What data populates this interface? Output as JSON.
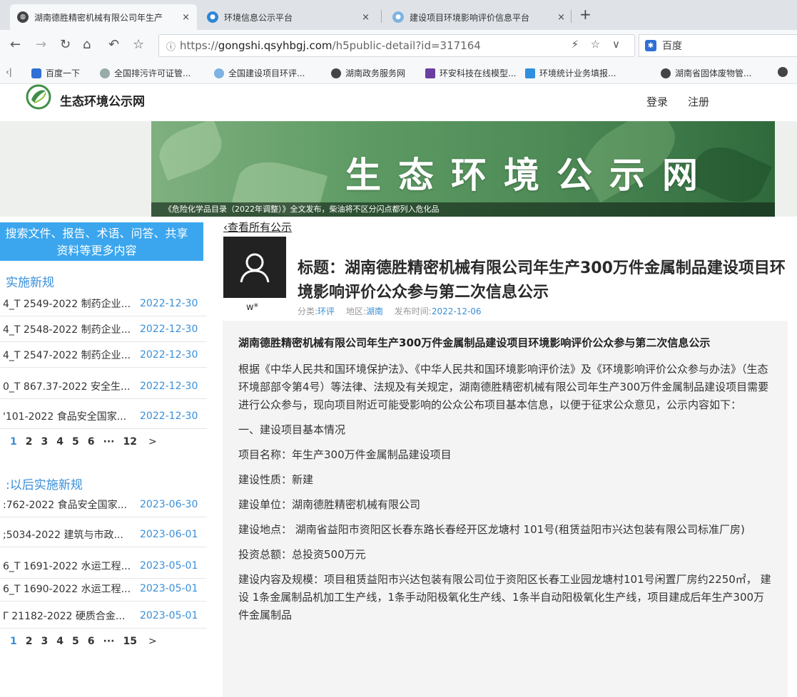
{
  "browser": {
    "tabs": [
      {
        "label": "湖南德胜精密机械有限公司年生产",
        "close": "×"
      },
      {
        "label": "环境信息公示平台",
        "close": "×"
      },
      {
        "label": "建设项目环境影响评价信息平台",
        "close": "×"
      }
    ],
    "new_tab": "+",
    "url_scheme": "https://",
    "url_host": "gongshi.qsyhbgj.com",
    "url_path": "/h5public-detail?id=317164",
    "search_engine": "百度",
    "bookmarks": [
      "百度一下",
      "全国排污许可证管...",
      "全国建设项目环评...",
      "湖南政务服务网",
      "环安科技在线模型...",
      "环境统计业务填报...",
      "湖南省固体废物管..."
    ]
  },
  "site": {
    "name": "生态环境公示网",
    "login": "登录",
    "register": "注册",
    "banner_title": "生态环境公示网",
    "ticker": "《危险化学品目录（2022年调整）》全文发布，柴油将不区分闪点都列入危化品"
  },
  "sidebar": {
    "search_cta": "搜索文件、报告、术语、问答、共享资料等更多内容",
    "section1_title": "实施新规",
    "section1_items": [
      {
        "title": "4_T 2549-2022 制药企业...",
        "date": "2022-12-30"
      },
      {
        "title": "4_T 2548-2022 制药企业...",
        "date": "2022-12-30"
      },
      {
        "title": "4_T 2547-2022 制药企业...",
        "date": "2022-12-30"
      },
      {
        "title": "0_T 867.37-2022 安全生...",
        "date": "2022-12-30"
      },
      {
        "title": "'101-2022 食品安全国家...",
        "date": "2022-12-30"
      }
    ],
    "section1_pager": [
      "1",
      "2",
      "3",
      "4",
      "5",
      "6",
      "···",
      "12",
      ">"
    ],
    "section2_title": ":以后实施新规",
    "section2_items": [
      {
        "title": ":762-2022 食品安全国家...",
        "date": "2023-06-30"
      },
      {
        "title": ";5034-2022 建筑与市政...",
        "date": "2023-06-01"
      },
      {
        "title": "6_T 1691-2022 水运工程...",
        "date": "2023-05-01"
      },
      {
        "title": "6_T 1690-2022 水运工程...",
        "date": "2023-05-01"
      },
      {
        "title": "Γ 21182-2022 硬质合金...",
        "date": "2023-05-01"
      }
    ],
    "section2_pager": [
      "1",
      "2",
      "3",
      "4",
      "5",
      "6",
      "···",
      "15",
      ">"
    ]
  },
  "article": {
    "back_link": "查看所有公示",
    "author": "w*",
    "title": "标题：湖南德胜精密机械有限公司年生产300万件金属制品建设项目环境影响评价公众参与第二次信息公示",
    "meta_category_label": "分类:",
    "meta_category": "环评",
    "meta_region_label": "地区:",
    "meta_region": "湖南",
    "meta_date_label": "发布时间:",
    "meta_date": "2022-12-06",
    "content_title": "湖南德胜精密机械有限公司年生产300万件金属制品建设项目环境影响评价公众参与第二次信息公示",
    "paragraphs": [
      "根据《中华人民共和国环境保护法》、《中华人民共和国环境影响评价法》及《环境影响评价公众参与办法》（生态环境部部令第4号）等法律、法规及有关规定，湖南德胜精密机械有限公司年生产300万件金属制品建设项目需要进行公众参与，现向项目附近可能受影响的公众公布项目基本信息，以便于征求公众意见，公示内容如下：",
      "一、建设项目基本情况",
      "项目名称：年生产300万件金属制品建设项目",
      "建设性质：新建",
      "建设单位：湖南德胜精密机械有限公司",
      "建设地点： 湖南省益阳市资阳区长春东路长春经开区龙塘村 101号(租赁益阳市兴达包装有限公司标准厂房)",
      "投资总额：总投资500万元",
      "建设内容及规模：项目租赁益阳市兴达包装有限公司位于资阳区长春工业园龙塘村101号闲置厂房约2250㎡， 建设 1条金属制品机加工生产线，1条手动阳极氧化生产线、1条半自动阳极氧化生产线，项目建成后年生产300万件金属制品"
    ]
  }
}
